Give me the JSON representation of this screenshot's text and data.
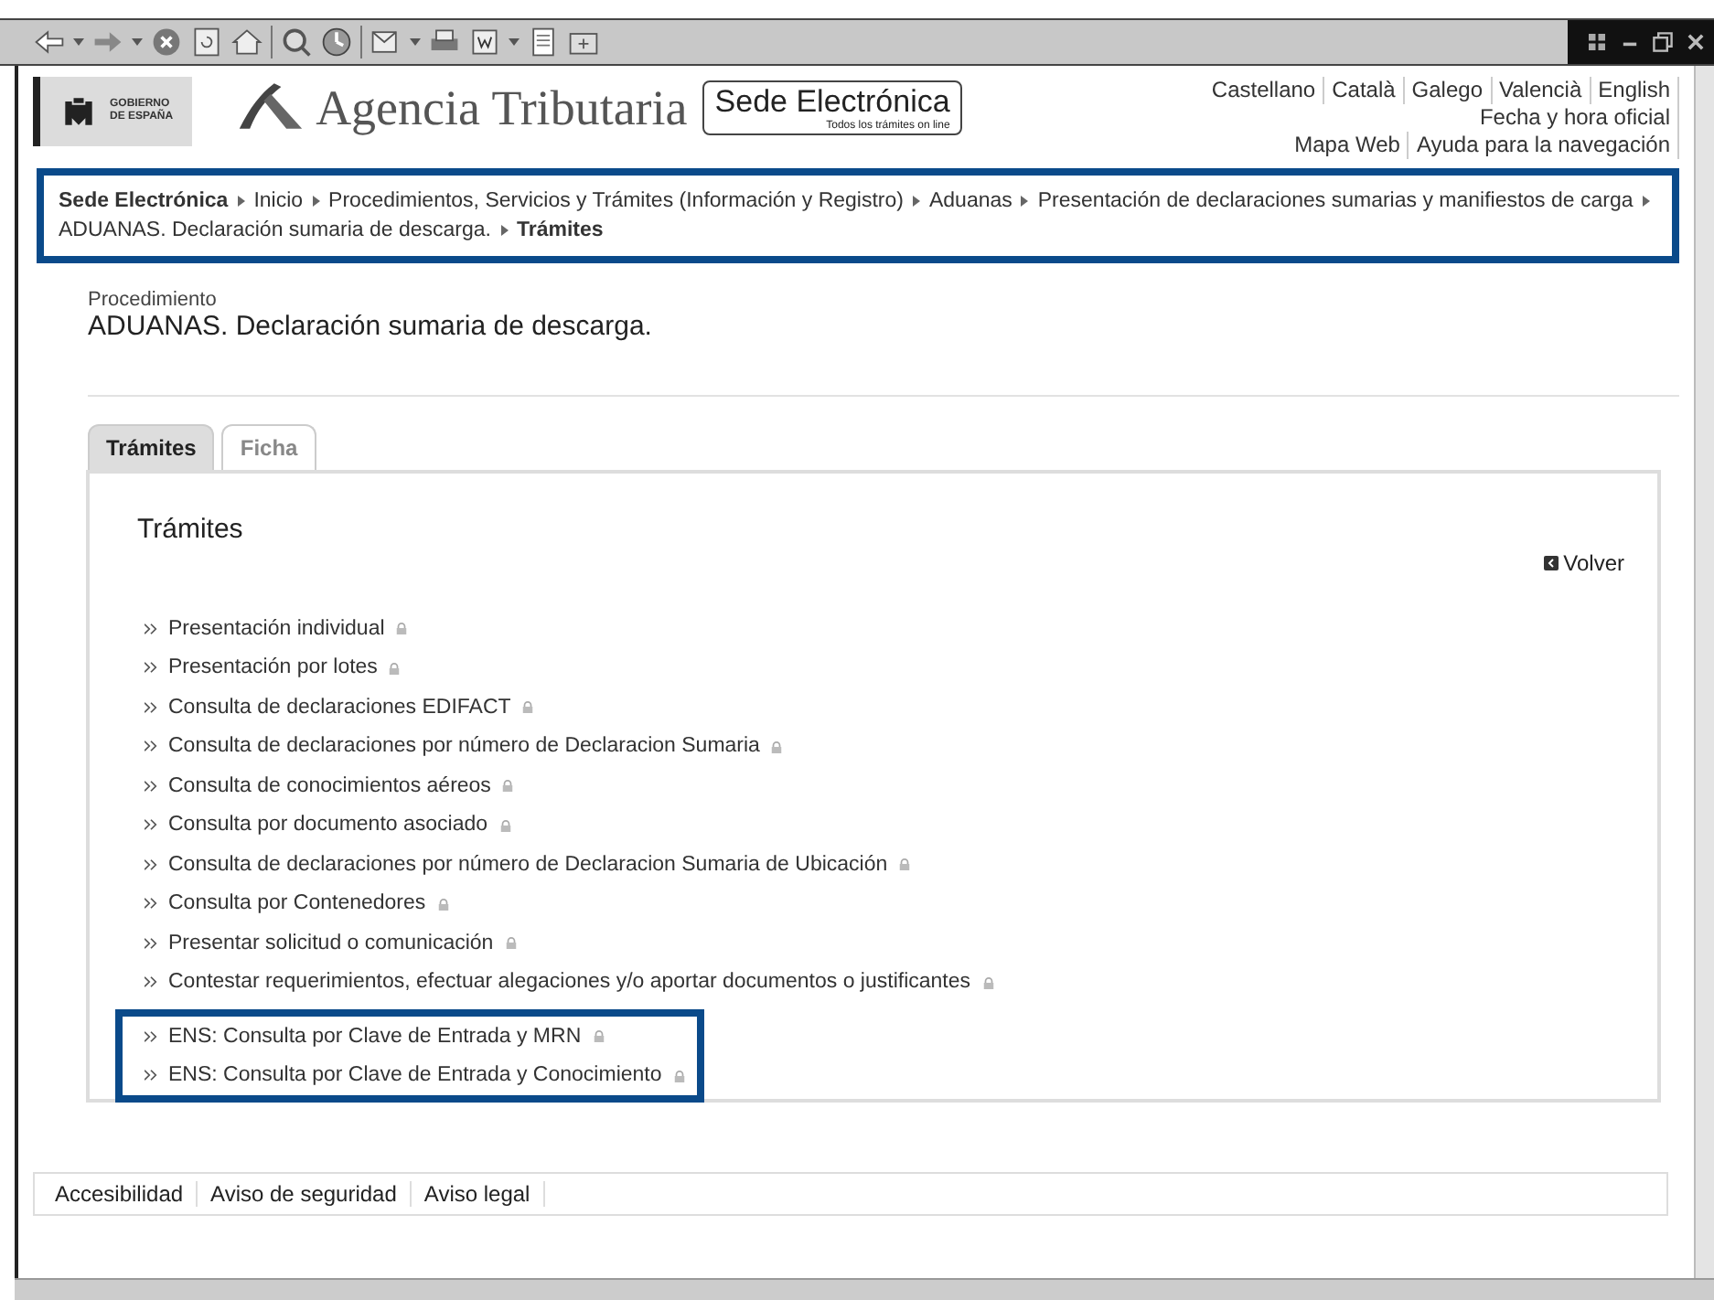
{
  "header": {
    "government": [
      "GOBIERNO",
      "DE ESPAÑA"
    ],
    "agency": "Agencia Tributaria",
    "sede": {
      "title": "Sede Electrónica",
      "subtitle": "Todos los trámites on line"
    },
    "languages": [
      "Castellano",
      "Català",
      "Galego",
      "Valencià",
      "English"
    ],
    "official_time": "Fecha y hora oficial",
    "utility_links": [
      "Mapa Web",
      "Ayuda para la navegación"
    ]
  },
  "breadcrumb": {
    "highlighted": true,
    "items": [
      {
        "text": "Sede Electrónica",
        "bold": true
      },
      {
        "text": "Inicio",
        "bold": false
      },
      {
        "text": "Procedimientos, Servicios y Trámites (Información y Registro)",
        "bold": false
      },
      {
        "text": "Aduanas",
        "bold": false
      },
      {
        "text": "Presentación de declaraciones sumarias y manifiestos de carga",
        "bold": false
      },
      {
        "text": "ADUANAS. Declaración sumaria de descarga.",
        "bold": false
      },
      {
        "text": "Trámites",
        "bold": true
      }
    ]
  },
  "procedure": {
    "label": "Procedimiento",
    "title": "ADUANAS. Declaración sumaria de descarga."
  },
  "tabs": [
    {
      "label": "Trámites",
      "selected": true
    },
    {
      "label": "Ficha",
      "selected": false
    }
  ],
  "panel": {
    "title": "Trámites",
    "back": "Volver",
    "groups": [
      {
        "highlighted": false,
        "items": [
          "Presentación individual",
          "Presentación por lotes",
          "Consulta de declaraciones EDIFACT",
          "Consulta de declaraciones por número de Declaracion Sumaria",
          "Consulta de conocimientos aéreos",
          "Consulta por documento asociado",
          "Consulta de declaraciones por número de Declaracion Sumaria de Ubicación",
          "Consulta por Contenedores",
          "Presentar solicitud o comunicación",
          "Contestar requerimientos, efectuar alegaciones y/o aportar documentos o justificantes"
        ]
      },
      {
        "highlighted": true,
        "items": [
          "ENS: Consulta por Clave de Entrada y MRN",
          "ENS: Consulta por Clave de Entrada y Conocimiento"
        ]
      }
    ]
  },
  "footer": [
    "Accesibilidad",
    "Aviso de seguridad",
    "Aviso legal"
  ]
}
